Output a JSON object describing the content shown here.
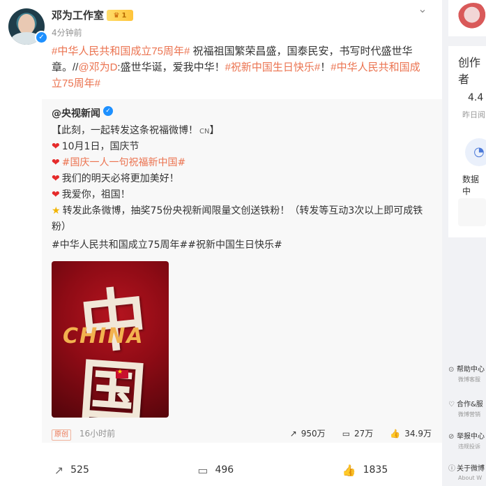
{
  "post": {
    "author": "邓为工作室",
    "badge_level": "1",
    "time": "4分钟前",
    "text_parts": {
      "hashtag1": "#中华人民共和国成立75周年#",
      "body1": " 祝福祖国繁荣昌盛，国泰民安，书写时代盛世华章。//",
      "mention": "@邓为D",
      "body2": ":盛世华诞，爱我中华！",
      "hashtag2": "#祝新中国生日快乐#",
      "body3": "！",
      "hashtag3": "#中华人民共和国成立75周年#"
    },
    "repost": {
      "author": "@央视新闻",
      "line1": "【此刻，一起转发这条祝福微博！",
      "line1_cn": "CN",
      "line1_end": "】",
      "line2": "10月1日，国庆节",
      "line3": "#国庆一人一句祝福新中国#",
      "line4": "我们的明天必将更加美好！",
      "line5": "我爱你，祖国！",
      "line6": "转发此条微博，抽奖75份央视新闻限量文创送铁粉！（转发等互动3次以上即可成铁粉）",
      "hashtags": "#中华人民共和国成立75周年##祝新中国生日快乐#",
      "poster": {
        "china": "CHINA",
        "zhong": "中",
        "guo": "国"
      },
      "tag": "原创",
      "time": "16小时前",
      "reposts": "950万",
      "comments": "27万",
      "likes": "34.9万"
    },
    "actions": {
      "reposts": "525",
      "comments": "496",
      "likes": "1835"
    }
  },
  "sidebar": {
    "title": "创作者",
    "num": "4.4",
    "sub": "昨日阅",
    "data_label": "数据中",
    "help1": "帮助中心",
    "help1_sub": "微博客服",
    "help2": "合作&服",
    "help2_sub": "微博营销",
    "help3": "举报中心",
    "help3_sub": "违规投诉",
    "help4": "关于微博",
    "help4_sub": "About W"
  }
}
